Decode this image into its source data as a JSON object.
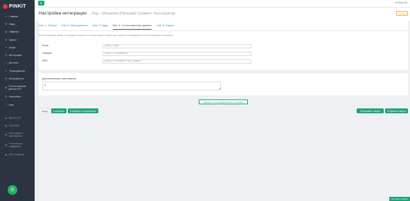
{
  "app": {
    "logo_text": "PINKIT"
  },
  "sidebar": {
    "items": [
      {
        "icon": "home-icon",
        "glyph": "⌂",
        "label": "Главная"
      },
      {
        "icon": "leads-icon",
        "glyph": "☰",
        "label": "Лиды"
      },
      {
        "icon": "offers-icon",
        "glyph": "◆",
        "label": "Офферы"
      },
      {
        "icon": "calls-icon",
        "glyph": "✆",
        "label": "Купить"
      },
      {
        "icon": "stocks-icon",
        "glyph": "✦",
        "label": "Акции"
      },
      {
        "icon": "integration-icon",
        "glyph": "⚙",
        "label": "Интеграции"
      },
      {
        "icon": "access-icon",
        "glyph": "⚿",
        "label": "Доступы"
      },
      {
        "icon": "telegram-icon",
        "glyph": "✈",
        "label": "Телемаркетинг"
      },
      {
        "icon": "tools-icon",
        "glyph": "⚒",
        "label": "Инструменты"
      },
      {
        "icon": "stats-icon",
        "glyph": "▤",
        "label": "Статистические данные API"
      },
      {
        "icon": "settings-icon",
        "glyph": "⚙",
        "label": "Настройки"
      },
      {
        "icon": "help-icon",
        "glyph": "?",
        "label": "Help"
      }
    ],
    "secondary_items": [
      {
        "icon": "bitrix-icon",
        "glyph": "◉",
        "label": "Bitrix24 CP"
      },
      {
        "icon": "amo-icon",
        "glyph": "◉",
        "label": "AmoCRM"
      },
      {
        "icon": "partner-icon",
        "glyph": "◉",
        "label": "Интеграции с партнерами"
      },
      {
        "icon": "support-icon",
        "glyph": "◉",
        "label": "Техническая поддержка"
      },
      {
        "icon": "api-icon",
        "glyph": "◉",
        "label": "API и Пиксель"
      }
    ]
  },
  "topbar": {
    "user": "⊕ Вася Пу"
  },
  "header": {
    "title": "Настройка интеграции",
    "subtitle": "- Лид - обновлен (Прогрев) Сегмент: Конструктор",
    "help_label": "Помощь"
  },
  "tabs": [
    {
      "label": "Шаг 1: Общее",
      "active": false
    },
    {
      "label": "Шаг 2: Инструменты",
      "active": false
    },
    {
      "label": "Шаг 3: Куда",
      "active": false
    },
    {
      "label": "Шаг 4: Сопоставление данных",
      "active": true
    },
    {
      "label": "Шаг 5: Запуск",
      "active": false
    }
  ],
  "hint": "Для сопоставления данных, полученных по заявке из источника, введите символ «{}» с выбором из выпадающего списка необходимых переменных.",
  "fields": [
    {
      "label": "Email",
      "value": "{{step.1.0}}"
    },
    {
      "label": "Телефон",
      "value": "{{step.2.0 default}}"
    },
    {
      "label": "ФИО",
      "value": "{{step.2.0 default first_name}}"
    }
  ],
  "comment": {
    "label": "Дополнительные поля запроса",
    "value": "{}"
  },
  "add_step_button": "Добавить последовательность отправки",
  "buttons": {
    "plain": "Назад",
    "save": "Сохранить",
    "save_continue": "Сохранить и продолжить",
    "send_test": "Тестировать запрос",
    "send_request": "Отправить запрос"
  },
  "bottom_right": "Поставить вопрос"
}
